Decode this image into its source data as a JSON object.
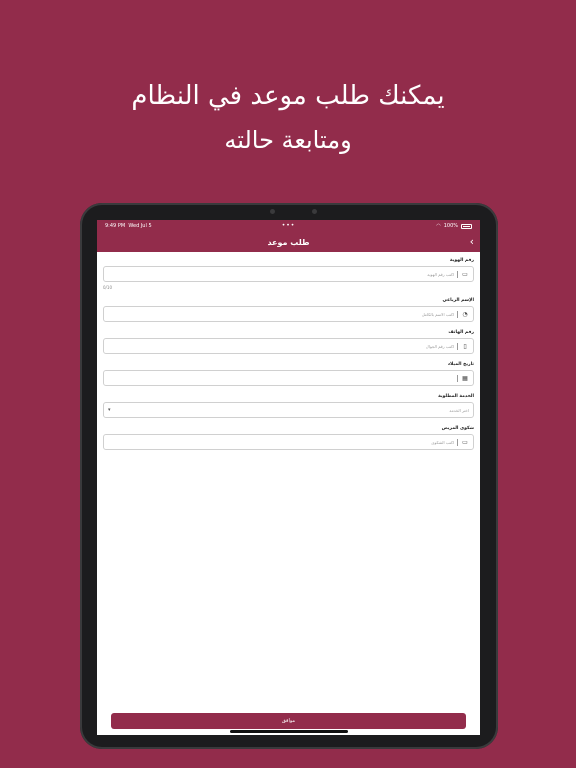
{
  "headline": {
    "line1": "يمكنك طلب موعد في النظام",
    "line2": "ومتابعة حالته"
  },
  "statusbar": {
    "time": "9:49 PM",
    "date": "Wed Jul 5",
    "dots": "•••",
    "battery": "100%"
  },
  "navbar": {
    "title": "طلب موعد",
    "back_icon": "chevron-left-icon"
  },
  "form": {
    "fields": [
      {
        "label": "رقم الهوية",
        "placeholder": "اكتب رقم الهوية",
        "icon": "id-card-icon",
        "counter": "0/10"
      },
      {
        "label": "الإسم الرباعي",
        "placeholder": "اكتب الاسم بالكامل",
        "icon": "person-icon"
      },
      {
        "label": "رقم الهاتف",
        "placeholder": "اكتب رقم الجوال",
        "icon": "phone-icon"
      },
      {
        "label": "تاريخ الميلاد",
        "placeholder": "",
        "icon": "calendar-icon"
      },
      {
        "label": "الخدمة المطلوبة",
        "placeholder": "اختر الخدمة",
        "icon": "chevron-down-icon"
      },
      {
        "label": "شكوى المريض",
        "placeholder": "اكتب الشكوى",
        "icon": "monitor-icon"
      }
    ],
    "submit_label": "موافق"
  },
  "colors": {
    "brand": "#922c4b",
    "background": "#922c4b"
  }
}
